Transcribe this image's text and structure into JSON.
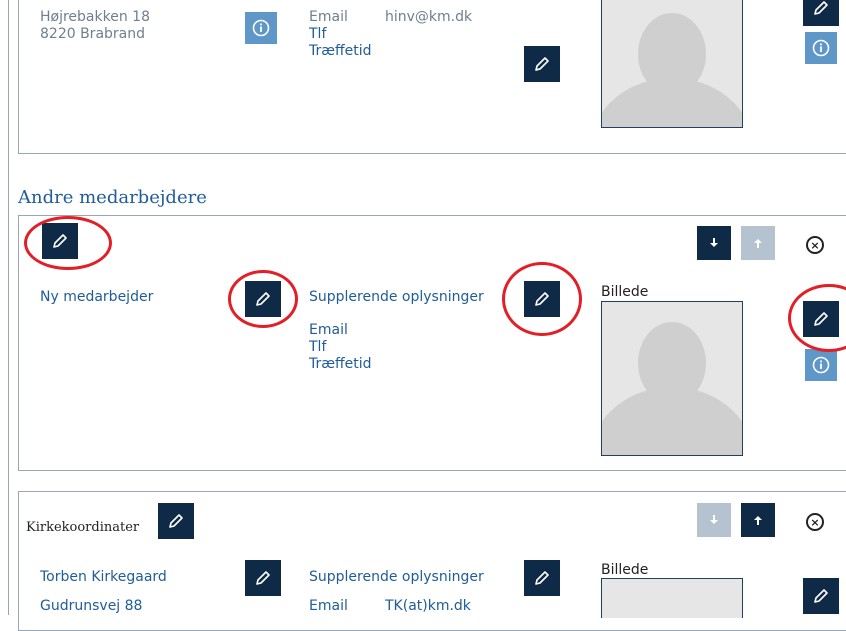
{
  "top": {
    "address_line1": "Højrebakken 18",
    "address_line2": "8220 Brabrand",
    "email_label": "Email",
    "email_value": "hinv@km.dk",
    "tlf_label": "Tlf",
    "traeffetid_label": "Træffetid"
  },
  "section": {
    "heading": "Andre medarbejdere"
  },
  "mid": {
    "name": "Ny medarbejder",
    "supplement_label": "Supplerende oplysninger",
    "email_label": "Email",
    "tlf_label": "Tlf",
    "traeffetid_label": "Træffetid",
    "image_label": "Billede"
  },
  "bottom": {
    "role_title": "Kirkekoordinater",
    "name": "Torben Kirkegaard",
    "address_line1": "Gudrunsvej 88",
    "supplement_label": "Supplerende oplysninger",
    "email_label": "Email",
    "email_value": "TK(at)km.dk",
    "image_label": "Billede"
  },
  "icons": {
    "edit": "pencil-icon",
    "info": "info-icon",
    "move_down": "arrow-down-icon",
    "move_up": "arrow-up-icon",
    "remove": "close-circle-icon"
  },
  "colors": {
    "link_blue": "#1f5c99",
    "button_dark": "#0e2a47",
    "info_blue": "#5f97c9",
    "annotation_red": "#e21f26"
  }
}
